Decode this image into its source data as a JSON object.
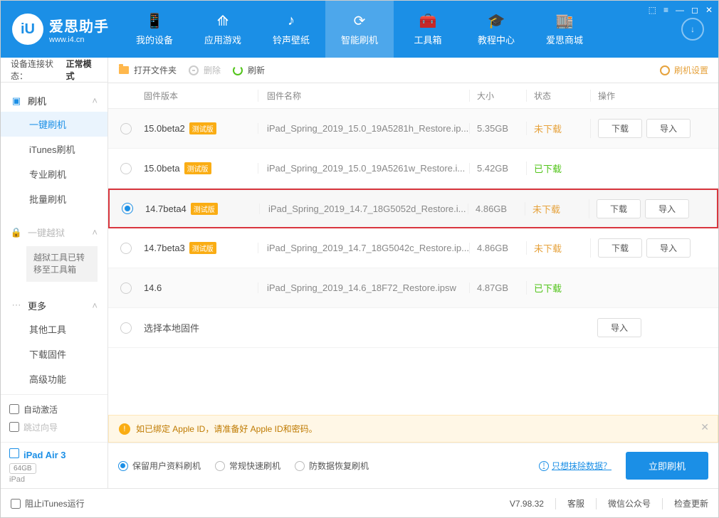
{
  "brand": {
    "cn": "爱思助手",
    "url": "www.i4.cn",
    "logo_letter": "iU"
  },
  "window_controls": [
    "⬚",
    "≡",
    "—",
    "◻",
    "✕"
  ],
  "nav": [
    {
      "label": "我的设备",
      "icon": "📱"
    },
    {
      "label": "应用游戏",
      "icon": "⟰"
    },
    {
      "label": "铃声壁纸",
      "icon": "♪"
    },
    {
      "label": "智能刷机",
      "icon": "⟳",
      "active": true
    },
    {
      "label": "工具箱",
      "icon": "🧰"
    },
    {
      "label": "教程中心",
      "icon": "🎓"
    },
    {
      "label": "爱思商城",
      "icon": "🏬"
    }
  ],
  "download_icon": "↓",
  "sidebar": {
    "status_label": "设备连接状态：",
    "status_value": "正常模式",
    "flash": {
      "title": "刷机",
      "items": [
        "一键刷机",
        "iTunes刷机",
        "专业刷机",
        "批量刷机"
      ],
      "active_index": 0
    },
    "jailbreak": {
      "title": "一键越狱",
      "notice": "越狱工具已转移至工具箱"
    },
    "more": {
      "title": "更多",
      "items": [
        "其他工具",
        "下载固件",
        "高级功能"
      ]
    },
    "auto_activate": "自动激活",
    "skip_guide": "跳过向导",
    "device": {
      "name": "iPad Air 3",
      "storage": "64GB",
      "type": "iPad"
    }
  },
  "toolbar": {
    "open": "打开文件夹",
    "delete": "删除",
    "refresh": "刷新",
    "settings": "刷机设置"
  },
  "columns": {
    "version": "固件版本",
    "name": "固件名称",
    "size": "大小",
    "status": "状态",
    "ops": "操作"
  },
  "firmware": [
    {
      "v": "15.0beta2",
      "beta": true,
      "name": "iPad_Spring_2019_15.0_19A5281h_Restore.ip...",
      "size": "5.35GB",
      "status": "未下载",
      "status_cls": "nd",
      "dl": true,
      "imp": true
    },
    {
      "v": "15.0beta",
      "beta": true,
      "name": "iPad_Spring_2019_15.0_19A5261w_Restore.i...",
      "size": "5.42GB",
      "status": "已下载",
      "status_cls": "dl",
      "dl": false,
      "imp": false
    },
    {
      "v": "14.7beta4",
      "beta": true,
      "name": "iPad_Spring_2019_14.7_18G5052d_Restore.i...",
      "size": "4.86GB",
      "status": "未下载",
      "status_cls": "nd",
      "dl": true,
      "imp": true,
      "selected": true,
      "highlight": true
    },
    {
      "v": "14.7beta3",
      "beta": true,
      "name": "iPad_Spring_2019_14.7_18G5042c_Restore.ip...",
      "size": "4.86GB",
      "status": "未下载",
      "status_cls": "nd",
      "dl": true,
      "imp": true
    },
    {
      "v": "14.6",
      "beta": false,
      "name": "iPad_Spring_2019_14.6_18F72_Restore.ipsw",
      "size": "4.87GB",
      "status": "已下载",
      "status_cls": "dl",
      "dl": false,
      "imp": false
    }
  ],
  "local_row": "选择本地固件",
  "beta_badge": "测试版",
  "btn_download": "下载",
  "btn_import": "导入",
  "warn": "如已绑定 Apple ID，请准备好 Apple ID和密码。",
  "modes": [
    "保留用户资料刷机",
    "常规快速刷机",
    "防数据恢复刷机"
  ],
  "help_link": "只想抹除数据？",
  "primary": "立即刷机",
  "footer": {
    "block_itunes": "阻止iTunes运行",
    "version": "V7.98.32",
    "service": "客服",
    "wechat": "微信公众号",
    "update": "检查更新"
  }
}
